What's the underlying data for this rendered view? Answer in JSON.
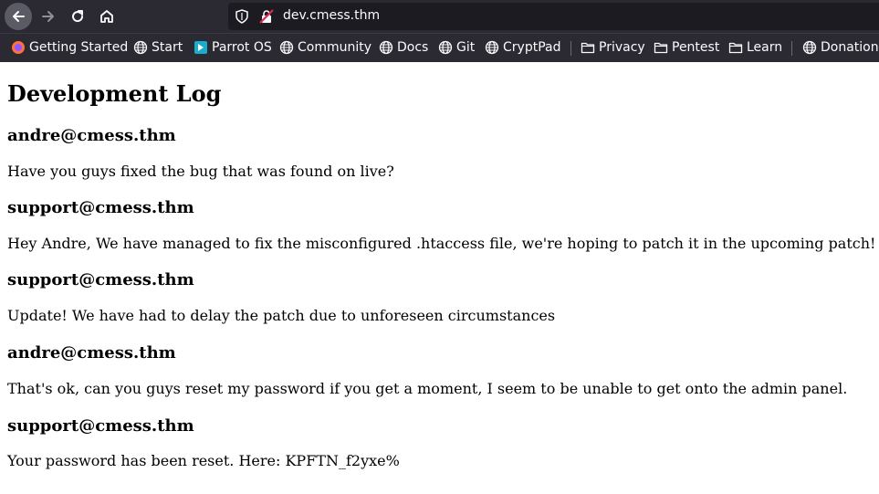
{
  "browser": {
    "url": "dev.cmess.thm",
    "bookmarks": [
      {
        "label": "Getting Started",
        "icon": "firefox-icon"
      },
      {
        "label": "Start",
        "icon": "globe-icon"
      },
      {
        "label": "Parrot OS",
        "icon": "parrot-icon"
      },
      {
        "label": "Community",
        "icon": "globe-icon"
      },
      {
        "label": "Docs",
        "icon": "globe-icon"
      },
      {
        "label": "Git",
        "icon": "globe-icon"
      },
      {
        "label": "CryptPad",
        "icon": "globe-icon"
      },
      {
        "label": "Privacy",
        "icon": "folder-icon"
      },
      {
        "label": "Pentest",
        "icon": "folder-icon"
      },
      {
        "label": "Learn",
        "icon": "folder-icon"
      },
      {
        "label": "Donations",
        "icon": "globe-icon"
      }
    ]
  },
  "page": {
    "title": "Development Log",
    "entries": [
      {
        "author": "andre@cmess.thm",
        "message": "Have you guys fixed the bug that was found on live?"
      },
      {
        "author": "support@cmess.thm",
        "message": "Hey Andre, We have managed to fix the misconfigured .htaccess file, we're hoping to patch it in the upcoming patch!"
      },
      {
        "author": "support@cmess.thm",
        "message": "Update! We have had to delay the patch due to unforeseen circumstances"
      },
      {
        "author": "andre@cmess.thm",
        "message": "That's ok, can you guys reset my password if you get a moment, I seem to be unable to get onto the admin panel."
      },
      {
        "author": "support@cmess.thm",
        "message": "Your password has been reset. Here: KPFTN_f2yxe%"
      }
    ]
  },
  "colors": {
    "chrome_bg": "#2b2a33",
    "urlbar_bg": "#1c1b22",
    "chrome_text": "#fbfbfe",
    "page_bg": "#ffffff",
    "page_text": "#000000"
  }
}
